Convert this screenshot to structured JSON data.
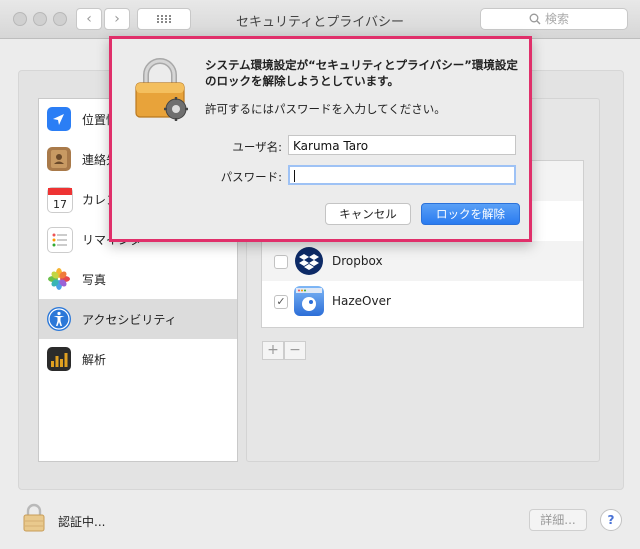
{
  "window": {
    "title": "セキュリティとプライバシー",
    "search_placeholder": "検索",
    "nav_back": "‹",
    "nav_forward": "›"
  },
  "sidebar": {
    "items": [
      {
        "label": "位置情",
        "icon": "location-arrow-icon",
        "selected": false
      },
      {
        "label": "連絡先",
        "icon": "contacts-book-icon",
        "selected": false
      },
      {
        "label": "カレン",
        "icon": "calendar-icon",
        "selected": false
      },
      {
        "label": "リマインダー",
        "icon": "reminders-list-icon",
        "selected": false
      },
      {
        "label": "写真",
        "icon": "photos-flower-icon",
        "selected": false
      },
      {
        "label": "アクセシビリティ",
        "icon": "accessibility-person-icon",
        "selected": true
      },
      {
        "label": "解析",
        "icon": "analytics-grid-icon",
        "selected": false
      }
    ]
  },
  "app_list": {
    "rows": [
      {
        "label": "",
        "checked": false
      },
      {
        "label": "",
        "checked": false
      },
      {
        "label": "Dropbox",
        "checked": false,
        "icon": "dropbox-icon"
      },
      {
        "label": "HazeOver",
        "checked": true,
        "icon": "hazeover-icon"
      }
    ],
    "add_label": "+",
    "remove_label": "−"
  },
  "footer": {
    "lock_text": "認証中...",
    "details_label": "詳細...",
    "help_label": "?"
  },
  "dialog": {
    "title_line1": "システム環境設定が“セキュリティとプライバシー”環境設定",
    "title_line2": "のロックを解除しようとしています。",
    "message": "許可するにはパスワードを入力してください。",
    "username_label": "ユーザ名:",
    "username_value": "Karuma Taro",
    "password_label": "パスワード:",
    "password_value": "",
    "cancel_label": "キャンセル",
    "unlock_label": "ロックを解除"
  },
  "colors": {
    "highlight_border": "#e02f6a",
    "primary_button": "#2a7bf0"
  }
}
